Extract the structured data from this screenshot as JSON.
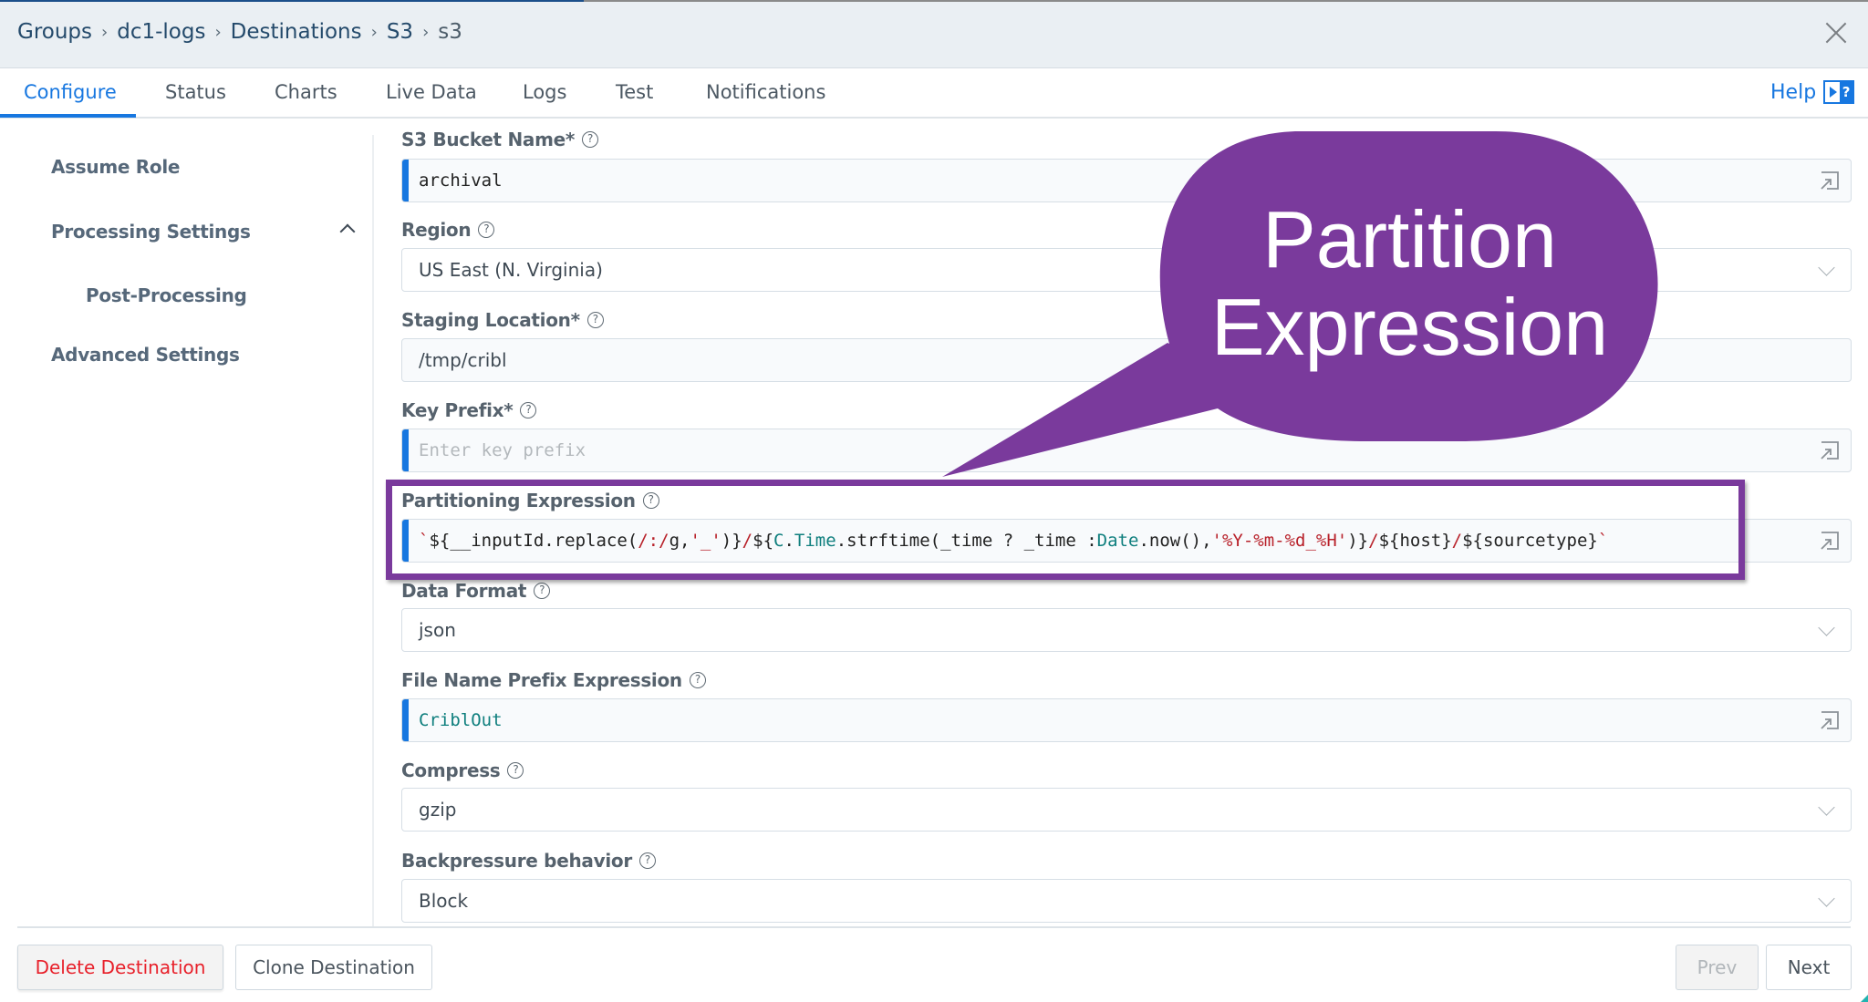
{
  "header": {
    "breadcrumb": [
      "Groups",
      "dc1-logs",
      "Destinations",
      "S3",
      "s3"
    ],
    "separator": "›",
    "close_icon": "close-icon"
  },
  "tabs": [
    {
      "label": "Configure",
      "active": true
    },
    {
      "label": "Status",
      "active": false
    },
    {
      "label": "Charts",
      "active": false
    },
    {
      "label": "Live Data",
      "active": false
    },
    {
      "label": "Logs",
      "active": false
    },
    {
      "label": "Test",
      "active": false
    },
    {
      "label": "Notifications",
      "active": false
    }
  ],
  "help": {
    "label": "Help",
    "icon": "help-panel-icon",
    "icon_glyph": "?"
  },
  "sidebar": {
    "items": [
      {
        "label": "Assume Role"
      },
      {
        "label": "Processing Settings",
        "expanded": true
      },
      {
        "label": "Post-Processing"
      },
      {
        "label": "Advanced Settings"
      }
    ]
  },
  "form": {
    "help_glyph": "?",
    "fields": {
      "s3_bucket_name": {
        "label": "S3 Bucket Name*",
        "value": "archival",
        "type": "expression"
      },
      "region": {
        "label": "Region",
        "value": "US East (N. Virginia)",
        "type": "select"
      },
      "staging_location": {
        "label": "Staging Location*",
        "value": "/tmp/cribl",
        "type": "text"
      },
      "key_prefix": {
        "label": "Key Prefix*",
        "value": "",
        "placeholder": "Enter key prefix",
        "type": "expression"
      },
      "partitioning_expression": {
        "label": "Partitioning Expression",
        "type": "expression",
        "value": "`${__inputId.replace(/:/g, '_')}/${C.Time.strftime(_time ? _time : Date.now(), '%Y-%m-%d_%H')}/${host}/${sourcetype}`",
        "tokens": [
          {
            "t": "`",
            "c": "str"
          },
          {
            "t": "${__inputId.replace(",
            "c": ""
          },
          {
            "t": "/:/",
            "c": "op"
          },
          {
            "t": "g, ",
            "c": ""
          },
          {
            "t": "'_'",
            "c": "str"
          },
          {
            "t": ")}",
            "c": ""
          },
          {
            "t": "/",
            "c": "op"
          },
          {
            "t": "${",
            "c": ""
          },
          {
            "t": "C",
            "c": "kw"
          },
          {
            "t": ".",
            "c": ""
          },
          {
            "t": "Time",
            "c": "kw"
          },
          {
            "t": ".strftime(_time ? _time : ",
            "c": ""
          },
          {
            "t": "Date",
            "c": "kw"
          },
          {
            "t": ".now(), ",
            "c": ""
          },
          {
            "t": "'%Y-%m-%d_%H'",
            "c": "str"
          },
          {
            "t": ")}",
            "c": ""
          },
          {
            "t": "/",
            "c": "op"
          },
          {
            "t": "${host}",
            "c": ""
          },
          {
            "t": "/",
            "c": "op"
          },
          {
            "t": "${sourcetype}",
            "c": ""
          },
          {
            "t": "`",
            "c": "str"
          }
        ]
      },
      "data_format": {
        "label": "Data Format",
        "value": "json",
        "type": "select"
      },
      "file_name_prefix": {
        "label": "File Name Prefix Expression",
        "value": "CriblOut",
        "type": "expression"
      },
      "compress": {
        "label": "Compress",
        "value": "gzip",
        "type": "select"
      },
      "backpressure": {
        "label": "Backpressure behavior",
        "value": "Block",
        "type": "select"
      }
    }
  },
  "annotation": {
    "callout_text_line1": "Partition",
    "callout_text_line2": "Expression",
    "color": "#7a3a9c"
  },
  "footer": {
    "delete_label": "Delete Destination",
    "clone_label": "Clone Destination",
    "prev_label": "Prev",
    "next_label": "Next",
    "prev_disabled": true
  },
  "colors": {
    "accent": "#1777e0",
    "danger": "#e8212b",
    "annotation": "#7a3a9c"
  }
}
